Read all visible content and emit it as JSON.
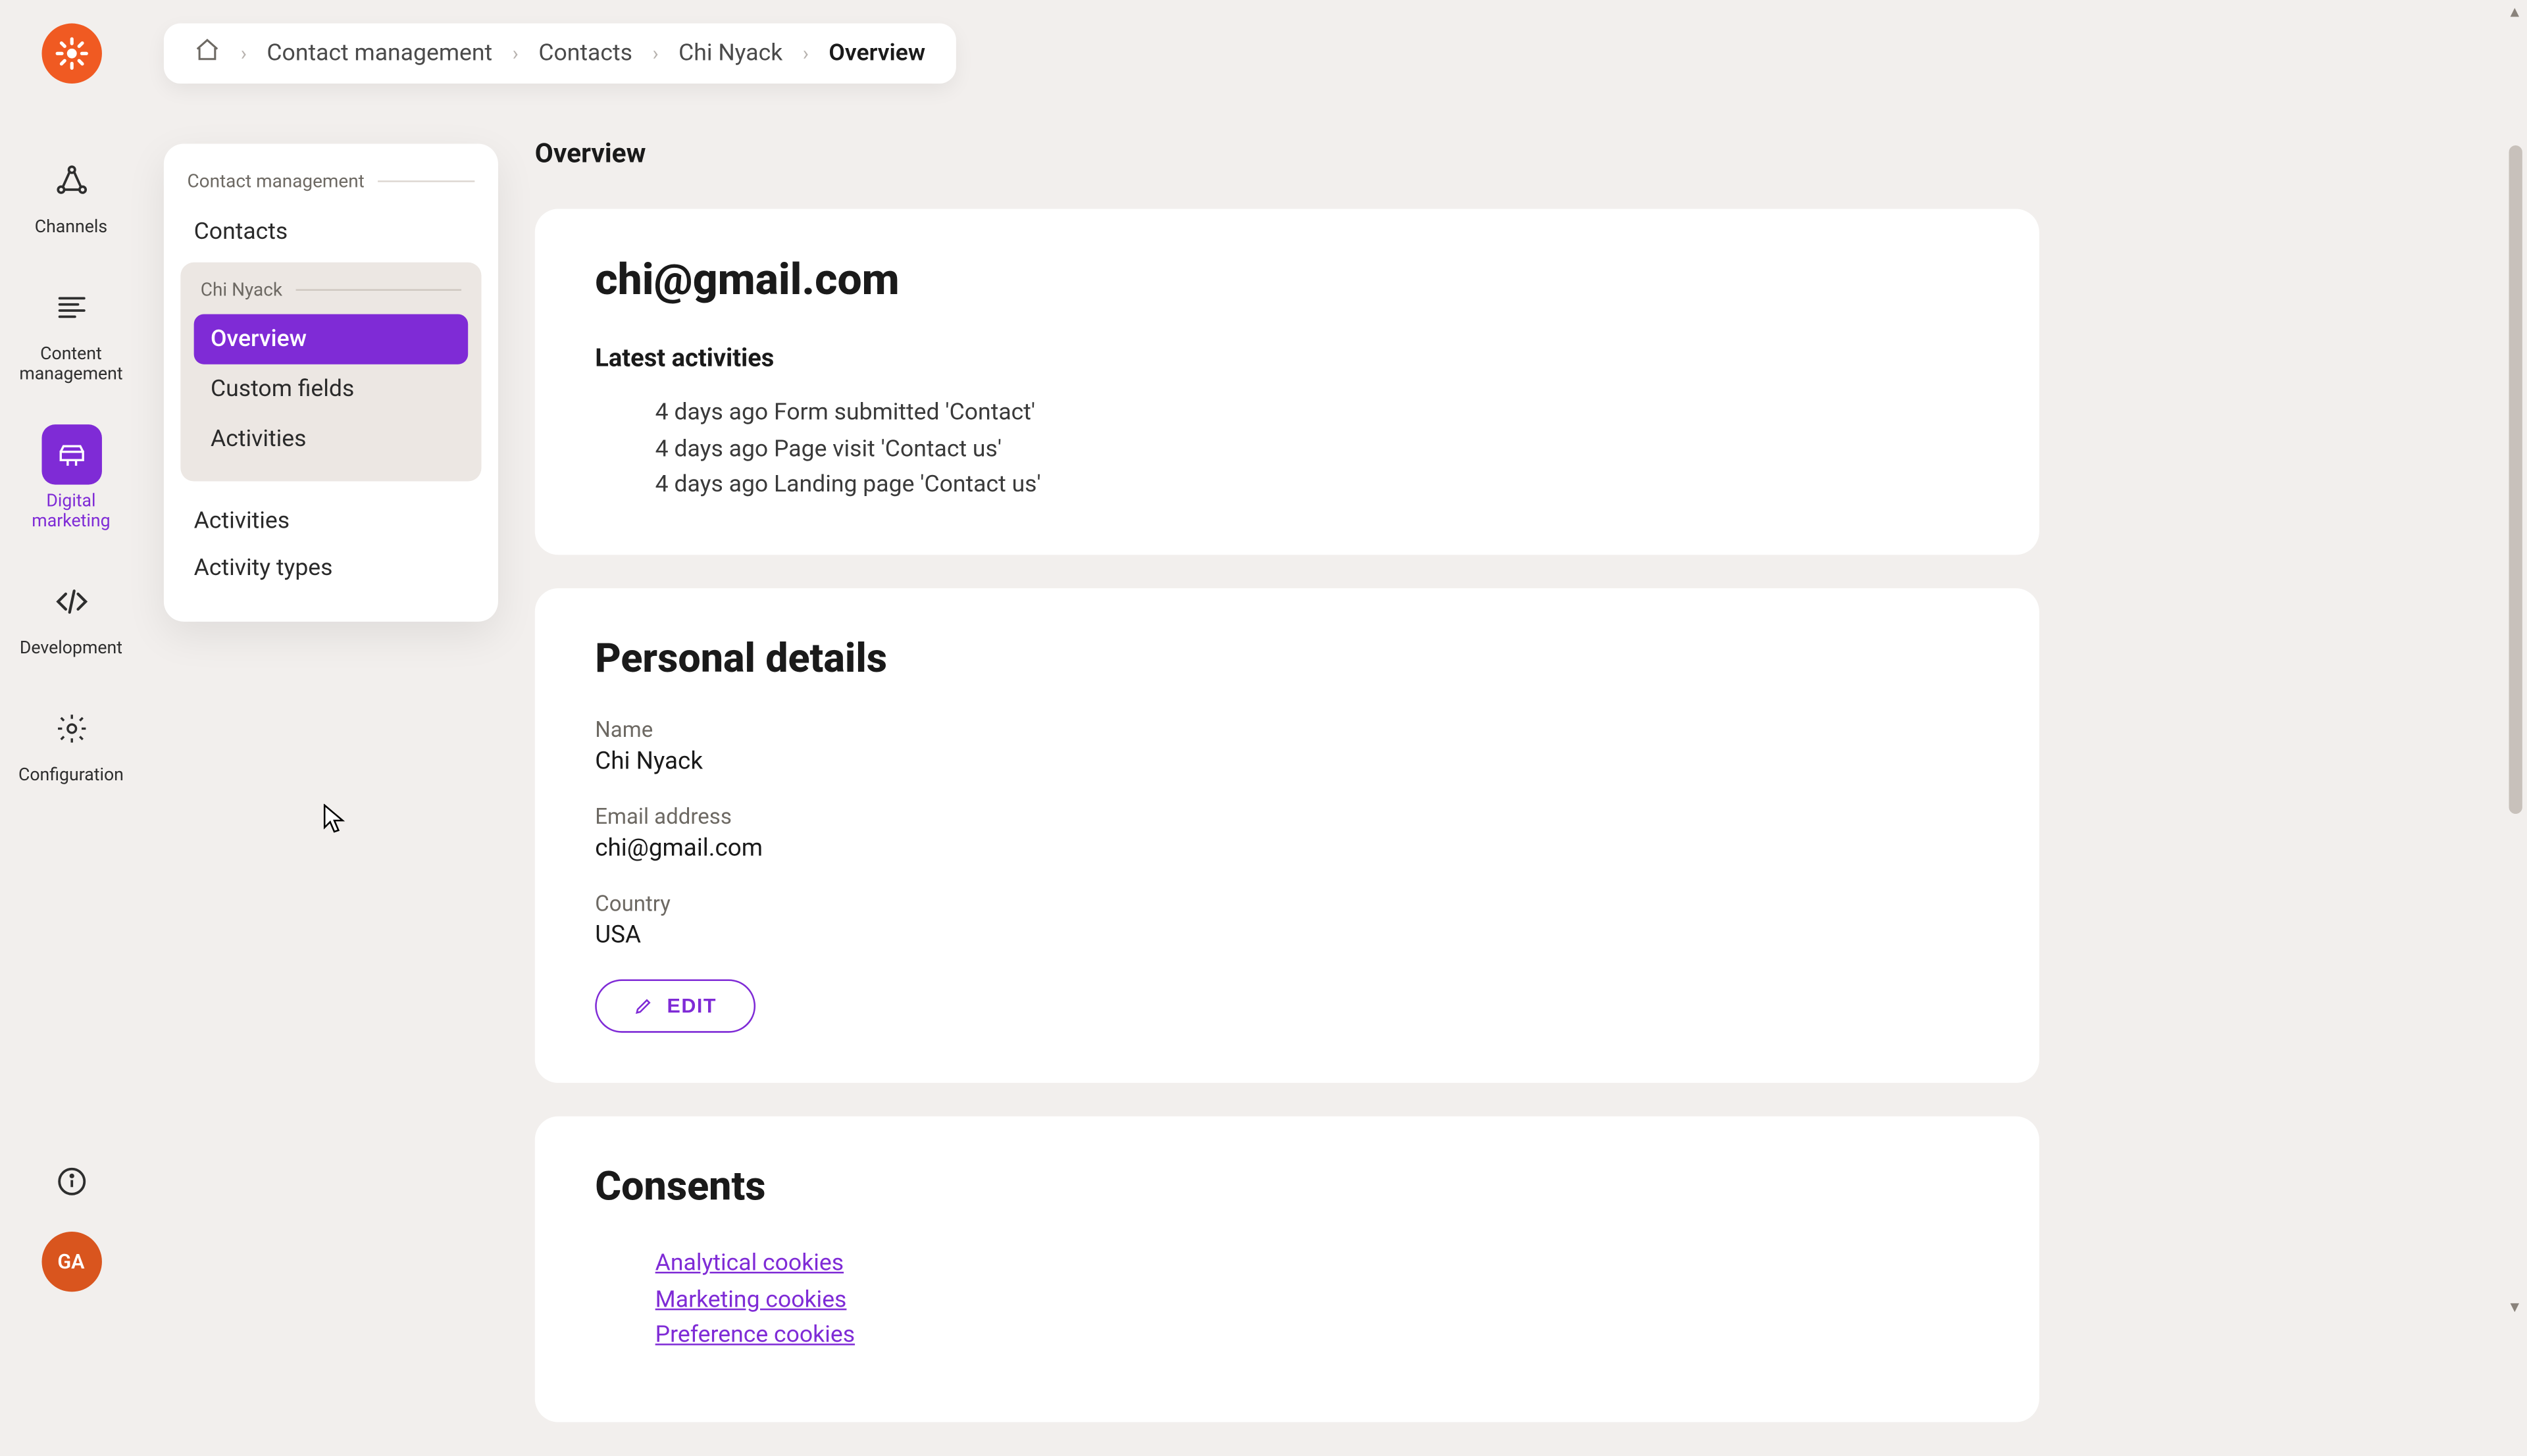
{
  "breadcrumb": {
    "items": [
      {
        "label": "Contact management"
      },
      {
        "label": "Contacts"
      },
      {
        "label": "Chi Nyack"
      },
      {
        "label": "Overview"
      }
    ]
  },
  "rail": {
    "items": [
      {
        "label": "Channels"
      },
      {
        "label": "Content management"
      },
      {
        "label": "Digital marketing"
      },
      {
        "label": "Development"
      },
      {
        "label": "Configuration"
      }
    ],
    "avatar_initials": "GA"
  },
  "local_nav": {
    "header": "Contact management",
    "lvl1_contacts": "Contacts",
    "sub": {
      "header": "Chi Nyack",
      "items": [
        {
          "label": "Overview"
        },
        {
          "label": "Custom fields"
        },
        {
          "label": "Activities"
        }
      ]
    },
    "lvl1_activities": "Activities",
    "lvl1_activity_types": "Activity types"
  },
  "page": {
    "title": "Overview"
  },
  "overview_card": {
    "email": "chi@gmail.com",
    "latest_activities_title": "Latest activities",
    "activities": [
      "4 days ago Form submitted 'Contact'",
      "4 days ago Page visit 'Contact us'",
      "4 days ago Landing page 'Contact us'"
    ]
  },
  "personal_details": {
    "title": "Personal details",
    "name_label": "Name",
    "name_value": "Chi Nyack",
    "email_label": "Email address",
    "email_value": "chi@gmail.com",
    "country_label": "Country",
    "country_value": "USA",
    "edit_label": "EDIT"
  },
  "consents_card": {
    "title": "Consents",
    "links": [
      "Analytical cookies",
      "Marketing cookies",
      "Preference cookies"
    ]
  }
}
